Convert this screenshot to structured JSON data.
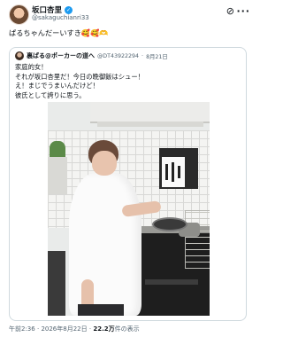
{
  "tweet": {
    "author_name": "坂口杏里",
    "author_handle": "@sakaguchianri33",
    "text": "ぱるちゃんだーいすき🥰🥰🫶",
    "footer": {
      "time": "午前2:36",
      "date": "2026年8月22日",
      "views_count": "22.2万",
      "views_label": "件の表示",
      "separator": "·"
    },
    "icons": [
      "verified-badge",
      "grok-icon",
      "more-icon"
    ]
  },
  "quote": {
    "author_name": "裏ぱる@ポーカーの道へ",
    "author_handle": "@DT43922294",
    "date": "8月21日",
    "separator": "·",
    "lines": [
      "家庭的女！",
      "それが坂口杏里だ！今日の晩御飯はシュー！",
      "え！まじでうまいんだけど！",
      "彼氏として誇りに思う。"
    ]
  },
  "colors": {
    "verified": "#1d9bf0",
    "secondary_text": "#536471",
    "border": "#cfd9de"
  }
}
